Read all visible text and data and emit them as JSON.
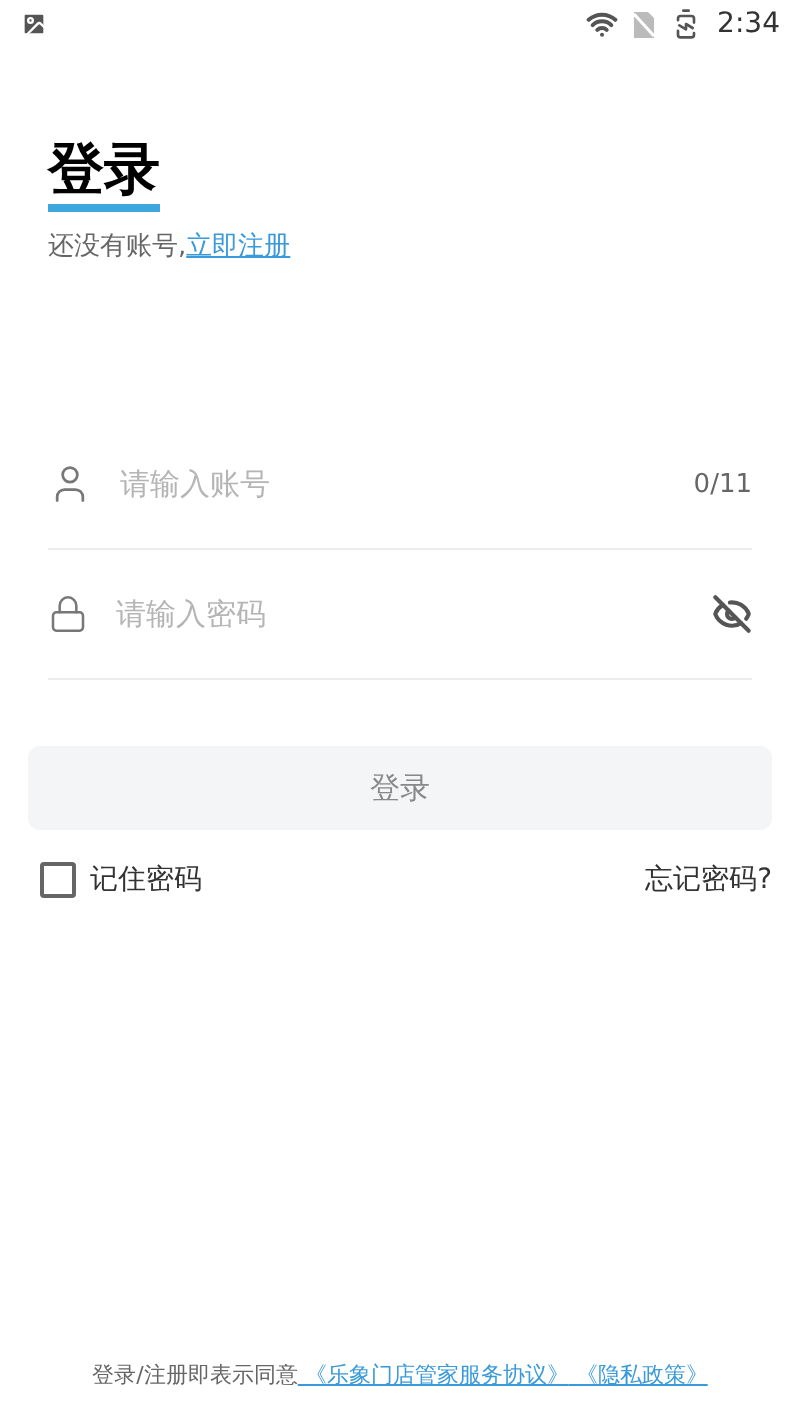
{
  "status_bar": {
    "time": "2:34"
  },
  "title": "登录",
  "register_prompt": {
    "text": "还没有账号,",
    "link": "立即注册"
  },
  "fields": [
    {
      "kind": "account",
      "placeholder": "请输入账号",
      "counter": "0/11"
    },
    {
      "kind": "password",
      "placeholder": "请输入密码",
      "password_visible": false
    }
  ],
  "login_button": {
    "label": "登录",
    "disabled": true
  },
  "remember": {
    "label": "记住密码",
    "checked": false
  },
  "forgot_link": "忘记密码?",
  "footer": {
    "text": "登录/注册即表示同意",
    "links": [
      " 《乐象门店管家服务协议》",
      " 《隐私政策》"
    ]
  }
}
